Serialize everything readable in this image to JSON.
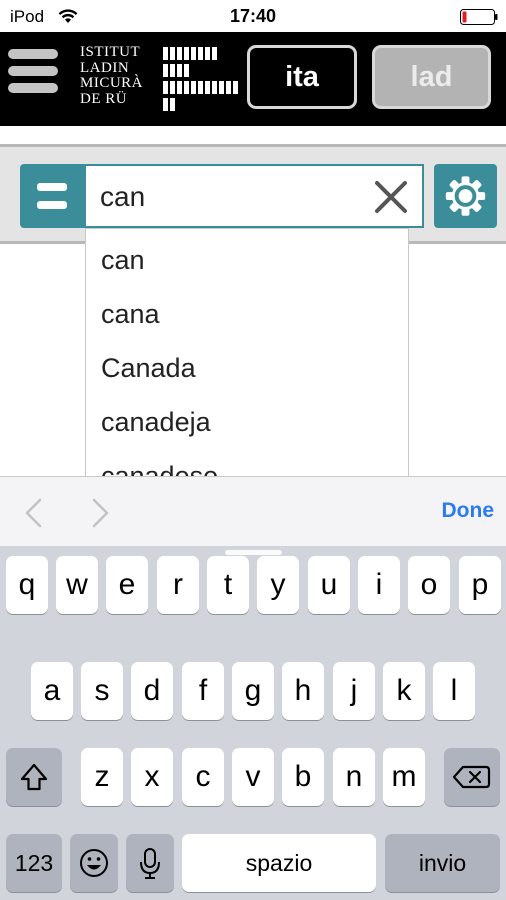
{
  "status_bar": {
    "carrier": "iPod",
    "time": "17:40"
  },
  "header": {
    "logo_lines": [
      "ISTITUT",
      "LADIN",
      "MICURÀ",
      "DE RÜ"
    ],
    "lang_buttons": [
      {
        "label": "ita",
        "selected": true
      },
      {
        "label": "lad",
        "selected": false
      }
    ]
  },
  "search": {
    "value": "can",
    "placeholder": ""
  },
  "autocomplete": {
    "items": [
      "can",
      "cana",
      "Canada",
      "canadeja",
      "canadese"
    ]
  },
  "keyboard_accessory": {
    "done_label": "Done"
  },
  "keyboard": {
    "row1": [
      "q",
      "w",
      "e",
      "r",
      "t",
      "y",
      "u",
      "i",
      "o",
      "p"
    ],
    "row2": [
      "a",
      "s",
      "d",
      "f",
      "g",
      "h",
      "j",
      "k",
      "l"
    ],
    "row3": [
      "z",
      "x",
      "c",
      "v",
      "b",
      "n",
      "m"
    ],
    "numbers_label": "123",
    "space_label": "spazio",
    "return_label": "invio"
  },
  "colors": {
    "accent": "#3b8d99",
    "header_bg": "#000000",
    "done_blue": "#2b7bf0",
    "battery_low": "#e02020"
  },
  "icons": {
    "wifi": "wifi-icon",
    "battery": "battery-icon",
    "menu": "hamburger-icon",
    "clear": "close-icon",
    "settings": "gear-icon",
    "shift": "shift-icon",
    "backspace": "backspace-icon",
    "emoji": "emoji-icon",
    "mic": "microphone-icon"
  }
}
